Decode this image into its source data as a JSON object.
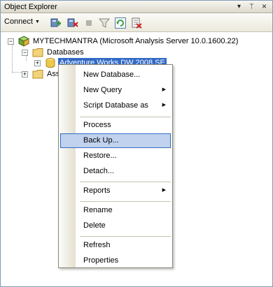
{
  "window": {
    "title": "Object Explorer",
    "pin_glyph": "▾",
    "autohide_glyph": "ᛘ",
    "close_glyph": "×"
  },
  "toolbar": {
    "connect_label": "Connect",
    "connect_arrow": "▼",
    "icons": [
      "connect-server-icon",
      "disconnect-icon",
      "stop-icon",
      "filter-icon",
      "refresh-icon",
      "script-icon"
    ]
  },
  "tree": {
    "server": {
      "label": "MYTECHMANTRA (Microsoft Analysis Server 10.0.1600.22)",
      "expander": "−"
    },
    "databases": {
      "label": "Databases",
      "expander": "−"
    },
    "database_item": {
      "label": "Adventure Works DW 2008 SE",
      "expander": "+"
    },
    "assemblies": {
      "label": "Asse",
      "expander": "+"
    }
  },
  "context_menu": {
    "submenu_glyph": "▶",
    "items": [
      {
        "label": "New Database..."
      },
      {
        "label": "New Query"
      },
      {
        "label": "Script Database as"
      },
      {
        "label": "Process"
      },
      {
        "label": "Back Up..."
      },
      {
        "label": "Restore..."
      },
      {
        "label": "Detach..."
      },
      {
        "label": "Reports"
      },
      {
        "label": "Rename"
      },
      {
        "label": "Delete"
      },
      {
        "label": "Refresh"
      },
      {
        "label": "Properties"
      }
    ]
  },
  "colors": {
    "selection": "#316ac5",
    "hover_fill": "#c1d2ee",
    "folder": "#f2d27a",
    "server_cube": "#7ab648"
  }
}
